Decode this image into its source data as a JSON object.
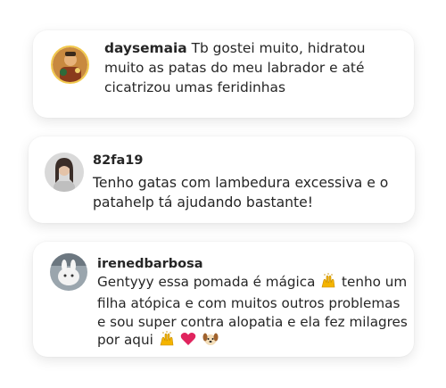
{
  "comments": [
    {
      "username": "daysemaia",
      "text": "Tb gostei muito, hidratou muito as patas do meu labrador e até cicatrizou umas feridinhas",
      "avatar_icon": "user-photo-avatar"
    },
    {
      "username": "82fa19",
      "text": "Tenho gatas com lambedura excessiva e o patahelp tá ajudando bastante!",
      "avatar_icon": "user-photo-avatar"
    },
    {
      "username": "irenedbarbosa",
      "text_part1": "Gentyyy essa pomada é mágica",
      "text_part2": "tenho um filha atópica e com muitos outros problemas e sou super contra alopatia e ela fez milagres por aqui",
      "emojis": [
        "raising-hands-emoji",
        "red-heart-emoji",
        "dog-face-emoji"
      ],
      "avatar_icon": "user-photo-avatar"
    }
  ],
  "colors": {
    "text": "#262626",
    "card_bg": "#ffffff",
    "heart": "#e0245e",
    "hands": "#f4b400"
  }
}
